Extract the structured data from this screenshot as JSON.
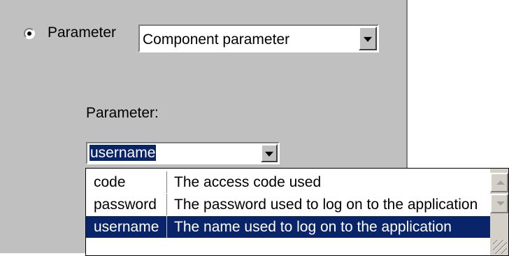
{
  "radio": {
    "label": "Parameter",
    "checked": true
  },
  "source_select": {
    "value": "Component parameter"
  },
  "parameter": {
    "label": "Parameter:",
    "value": "username"
  },
  "dropdown": {
    "rows": [
      {
        "name": "code",
        "description": "The access code used",
        "selected": false
      },
      {
        "name": "password",
        "description": "The password used to log on to the application",
        "selected": false
      },
      {
        "name": "username",
        "description": "The name used to log on to the application",
        "selected": true
      }
    ]
  },
  "icons": {
    "combo": "chevron-down-icon",
    "scroll_up": "scroll-up-icon",
    "scroll_down": "scroll-down-icon",
    "resize": "resize-grip-icon"
  },
  "colors": {
    "panel": "#c0c0c0",
    "selection": "#0a246a"
  }
}
